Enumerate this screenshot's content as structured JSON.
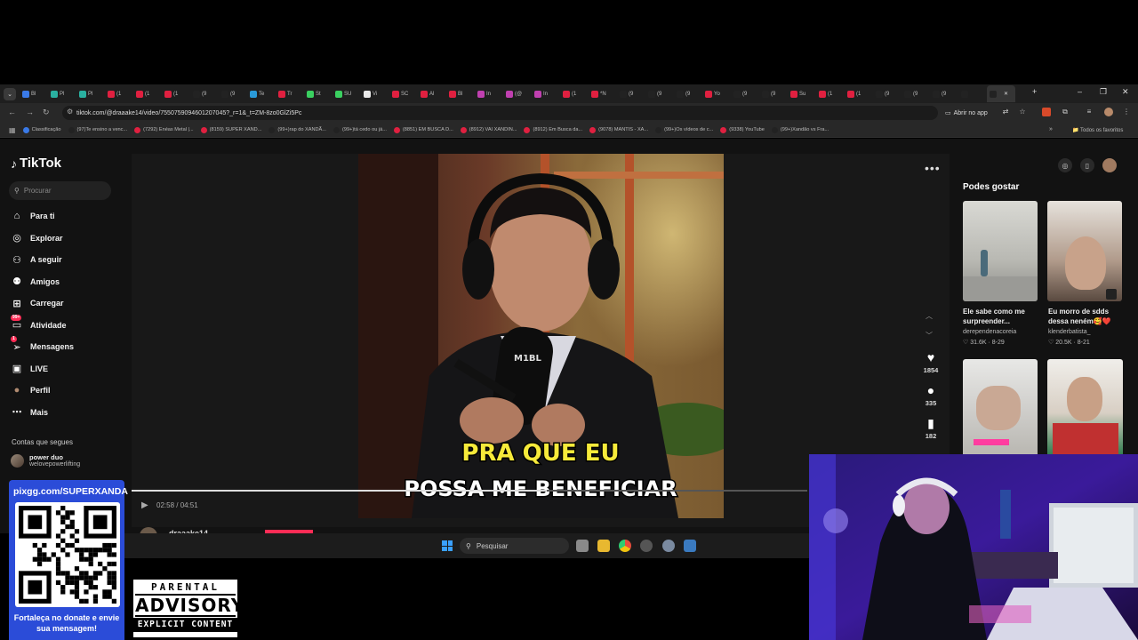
{
  "browser": {
    "tabs": [
      "Bl",
      "Pl",
      "Pl",
      "(1",
      "(1",
      "(1",
      "(9",
      "(9",
      "Te",
      "Tr",
      "St",
      "SU",
      "Vi",
      "SC",
      "Al",
      "Bl",
      "In",
      "(@",
      "In",
      "(1",
      "*N",
      "(9",
      "(9",
      "(9",
      "Yo",
      "(9",
      "(9",
      "Su",
      "(1",
      "(1",
      "(9",
      "(9",
      "(9",
      "",
      ""
    ],
    "url": "tiktok.com/@draaake14/video/7550759094601207045?_r=1&_t=ZM-8zo0GlZi5Pc",
    "open_app": "Abrir no app",
    "bookmarks": [
      "Classificação",
      "(97)Te ensino a venc...",
      "(7292) Enéas Metal |...",
      "(8159) SUPER XAND...",
      "(99+)rap do XANDÃ...",
      "(99+)tá cedo ou já...",
      "(8851) EM BUSCA D...",
      "(8912) VAI XANDIN...",
      "(8912) Em Busca da...",
      "(9078) MANTIS - XA...",
      "(99+)Os vídeos de c...",
      "(9338) YouTube",
      "(99+)Xandão vs Fra..."
    ],
    "all_bookmarks": "Todos os favoritos"
  },
  "tiktok": {
    "logo": "TikTok",
    "search_placeholder": "Procurar",
    "nav": [
      {
        "label": "Para ti",
        "icon": "home-icon"
      },
      {
        "label": "Explorar",
        "icon": "compass-icon"
      },
      {
        "label": "A seguir",
        "icon": "following-icon"
      },
      {
        "label": "Amigos",
        "icon": "friends-icon"
      },
      {
        "label": "Carregar",
        "icon": "upload-icon"
      },
      {
        "label": "Atividade",
        "icon": "activity-icon",
        "badge": "99+"
      },
      {
        "label": "Mensagens",
        "icon": "messages-icon",
        "badge": "1"
      },
      {
        "label": "LIVE",
        "icon": "live-icon"
      },
      {
        "label": "Perfil",
        "icon": "profile-icon"
      },
      {
        "label": "Mais",
        "icon": "more-icon"
      }
    ],
    "following_title": "Contas que segues",
    "following": [
      {
        "name": "power duo",
        "handle": "welovepowerlifting"
      }
    ],
    "video": {
      "caption_line1": "PRA QUE EU",
      "caption_line2": "POSSA ME BENEFICIAR",
      "mic_brand": "M1BL",
      "time": "02:58 / 04:51",
      "progress": 0.614,
      "author": "draaake14"
    },
    "actions": {
      "likes": "1854",
      "comments": "335",
      "saves": "182"
    },
    "suggest_title": "Podes gostar",
    "suggestions": [
      {
        "title": "Ele sabe como me surpreender...",
        "author": "derependenacoreia",
        "likes": "31.6K",
        "date": "8-29"
      },
      {
        "title": "Eu morro de sdds dessa neném🥰❤️",
        "author": "klenderbatista_",
        "likes": "20.5K",
        "date": "8-21"
      }
    ]
  },
  "taskbar": {
    "search_placeholder": "Pesquisar"
  },
  "overlay": {
    "qr_url": "pixgg.com/SUPERXANDA",
    "qr_text": "Fortaleça no donate e envie sua mensagem!",
    "parental_1": "PARENTAL",
    "parental_2": "ADVISORY",
    "parental_3": "EXPLICIT CONTENT"
  },
  "colors": {
    "tiktok_red": "#fe2c55",
    "qr_blue": "#2b4cd8",
    "windows_blue": "#3aa0ff"
  }
}
